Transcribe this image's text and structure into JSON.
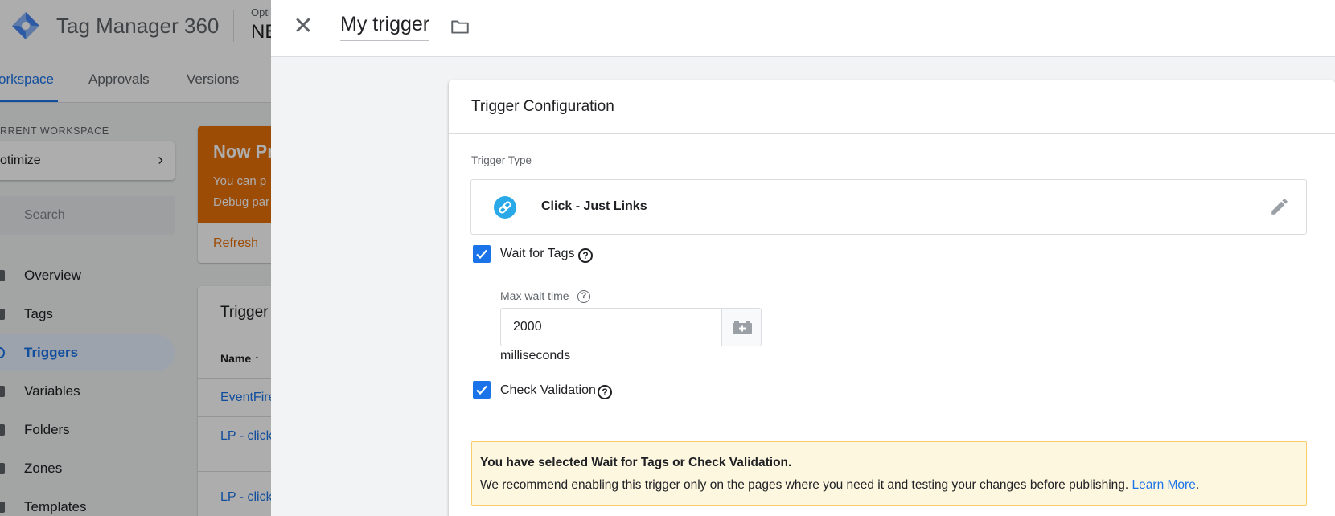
{
  "app": {
    "title": "Tag Manager 360",
    "account_small": "Opti",
    "account_big": "NE"
  },
  "nav_tabs": [
    {
      "label": "orkspace",
      "active": true
    },
    {
      "label": "Approvals",
      "active": false
    },
    {
      "label": "Versions",
      "active": false
    }
  ],
  "sidebar": {
    "current_workspace_label": "RRENT WORKSPACE",
    "workspace_name": "otimize",
    "search_placeholder": "Search",
    "items": [
      {
        "label": "Overview",
        "active": false
      },
      {
        "label": "Tags",
        "active": false
      },
      {
        "label": "Triggers",
        "active": true
      },
      {
        "label": "Variables",
        "active": false
      },
      {
        "label": "Folders",
        "active": false
      },
      {
        "label": "Zones",
        "active": false
      },
      {
        "label": "Templates",
        "active": false
      }
    ]
  },
  "banner": {
    "title": "Now Pr",
    "line1": "You can p",
    "line2": "Debug par",
    "refresh_label": "Refresh"
  },
  "triggers_card": {
    "title": "Trigger",
    "column_name": "Name",
    "rows": [
      "EventFire",
      "LP - click",
      "LP - click"
    ]
  },
  "panel": {
    "trigger_name": "My trigger",
    "card_title": "Trigger Configuration",
    "trigger_type_label": "Trigger Type",
    "trigger_type_value": "Click - Just Links",
    "wait_for_tags": {
      "label": "Wait for Tags",
      "checked": true
    },
    "max_wait_label": "Max wait time",
    "max_wait_value": "2000",
    "units": "milliseconds",
    "check_validation": {
      "label": "Check Validation",
      "checked": true
    },
    "warning": {
      "title": "You have selected Wait for Tags or Check Validation.",
      "body": "We recommend enabling this trigger only on the pages where you need it and testing your changes before publishing.",
      "link": "Learn More",
      "trailing": "."
    }
  },
  "colors": {
    "primary": "#1a73e8",
    "banner_orange": "#e8710a",
    "trigger_type_icon": "#29a9e8",
    "warning_bg": "#fef7e0"
  },
  "icons": {
    "close": "close-icon",
    "folder": "folder-icon",
    "link": "link-icon",
    "edit": "pencil-icon",
    "help": "help-icon",
    "variable": "add-variable-icon"
  }
}
